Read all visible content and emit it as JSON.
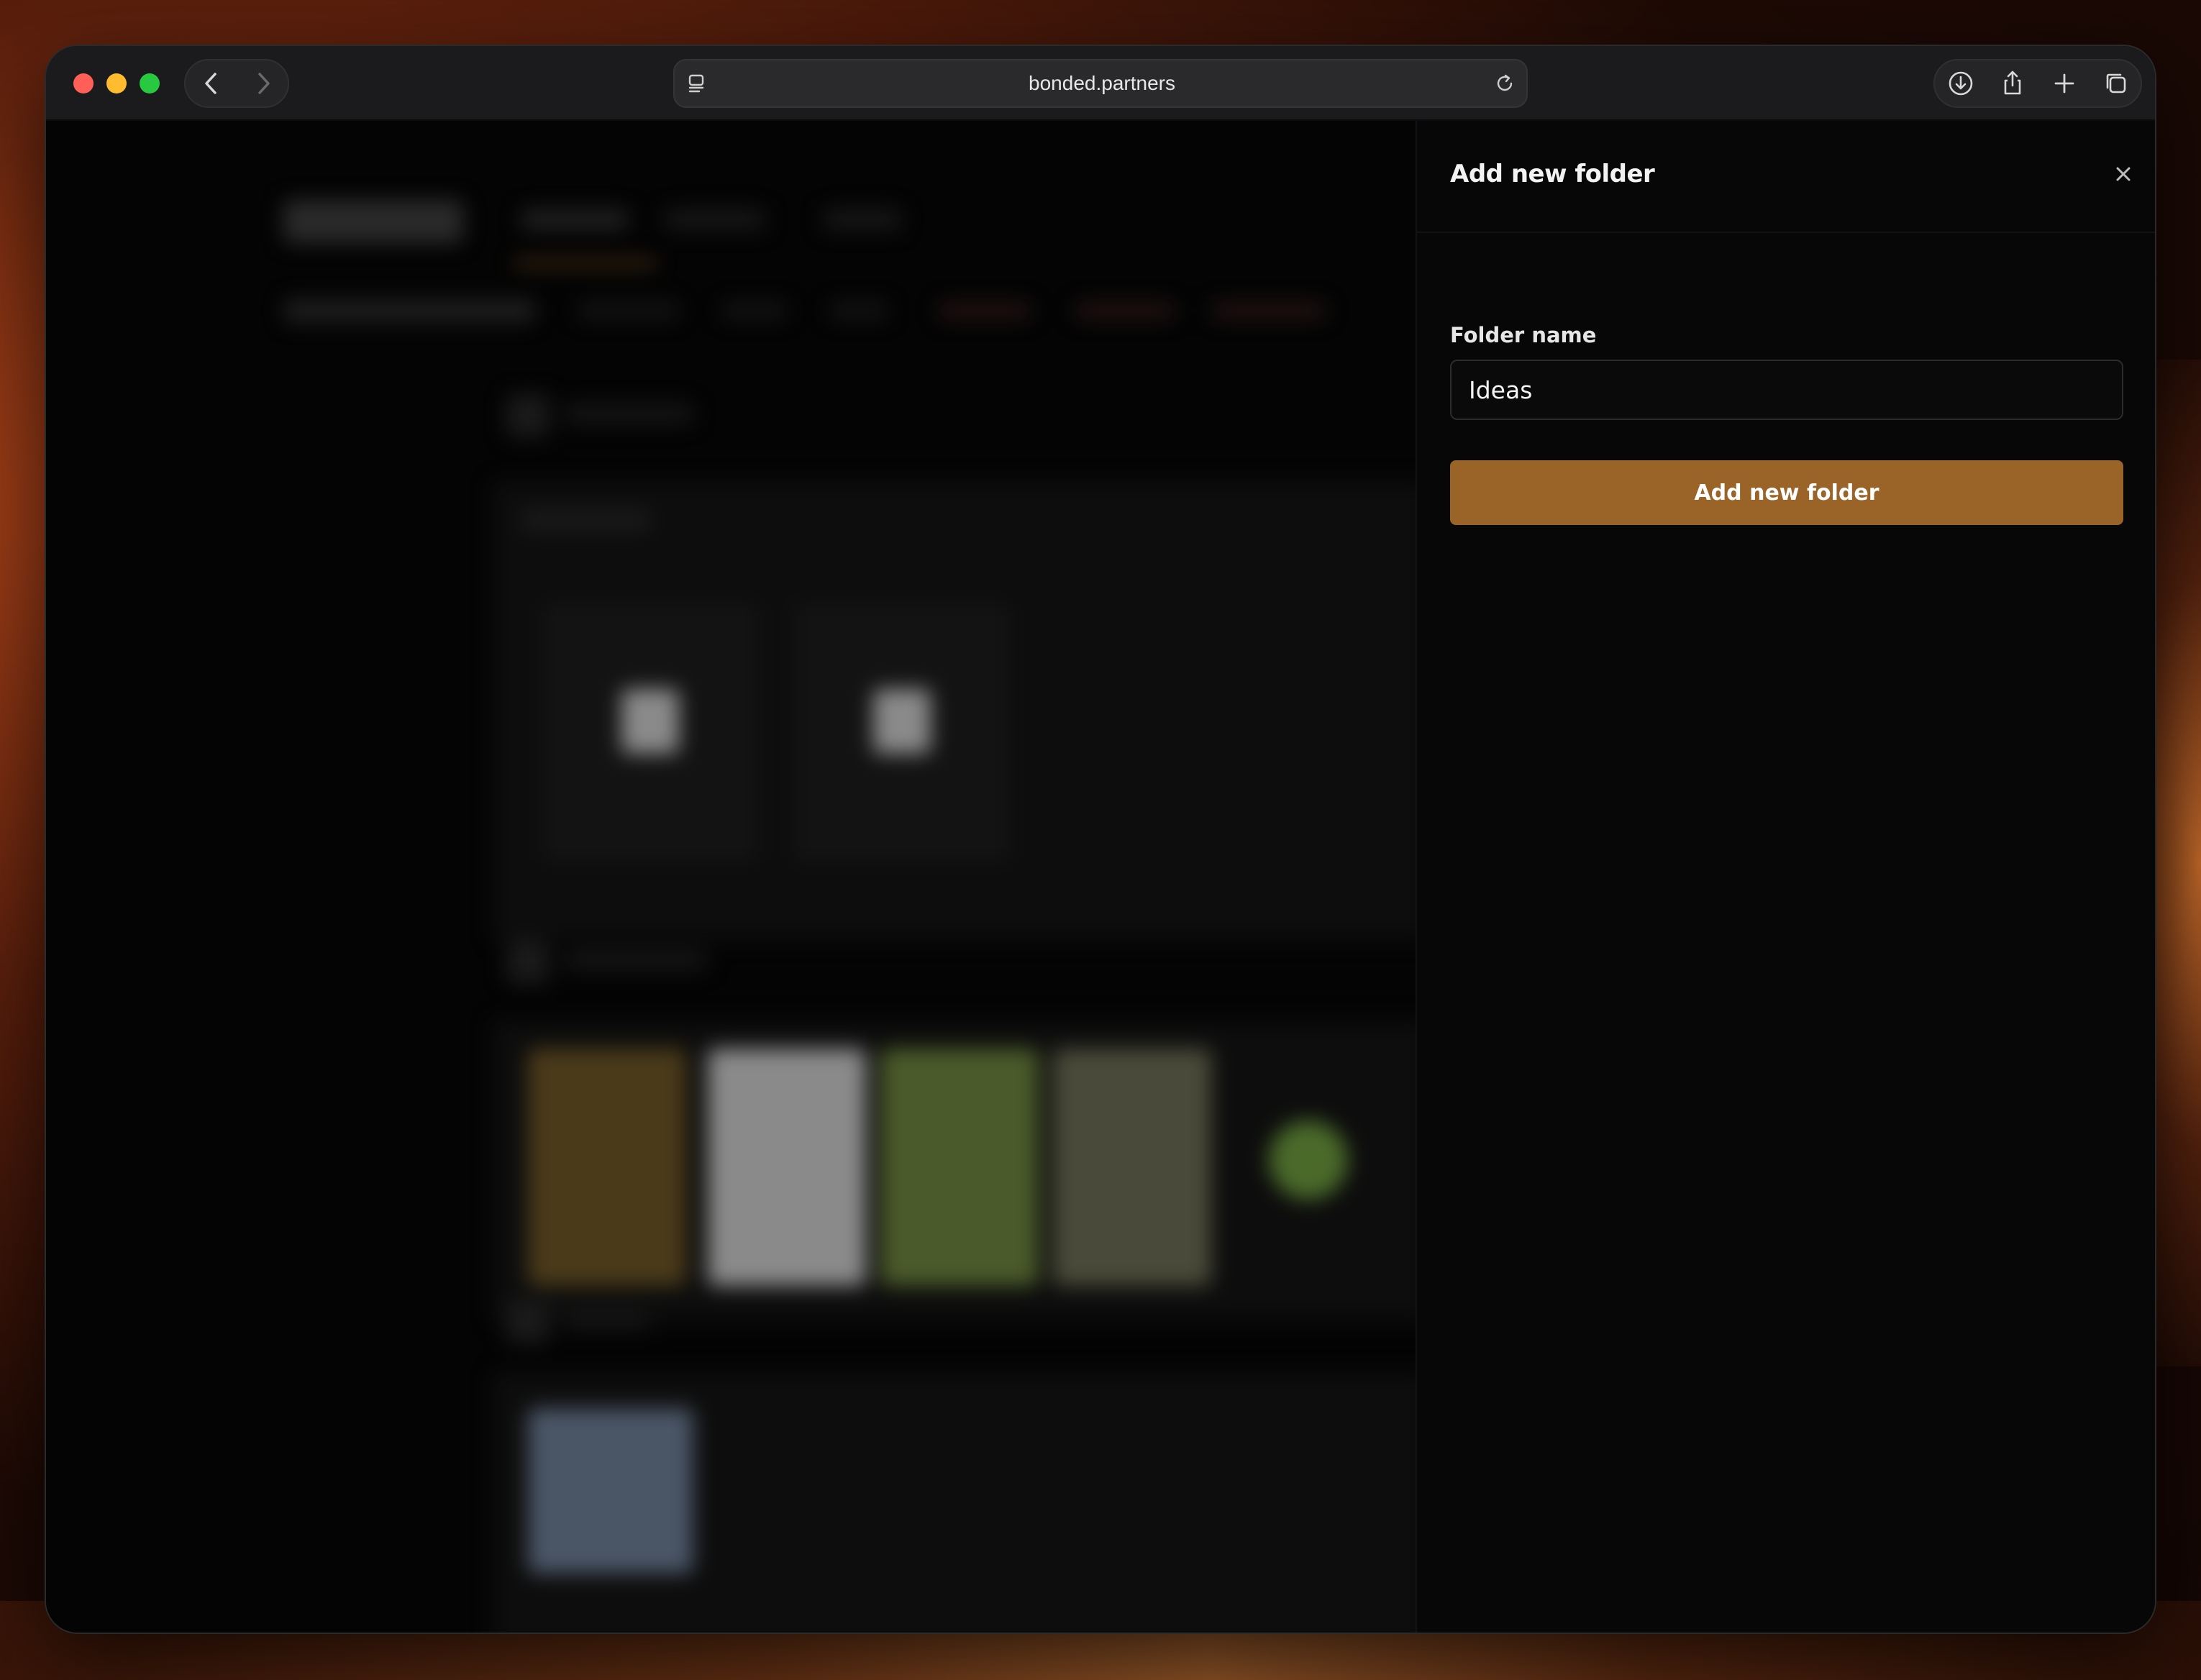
{
  "browser": {
    "url": "bonded.partners",
    "icons": {
      "back": "chevron-left-icon",
      "forward": "chevron-right-icon",
      "page_menu": "page-menu-icon",
      "reload": "reload-icon",
      "downloads": "download-icon",
      "share": "share-icon",
      "new_tab": "plus-icon",
      "tab_overview": "tabs-icon"
    }
  },
  "drawer": {
    "title": "Add new folder",
    "close_icon": "close-icon",
    "form": {
      "label": "Folder name",
      "value": "Ideas",
      "submit_label": "Add new folder"
    }
  },
  "colors": {
    "accent": "#9a6429",
    "drawer_bg": "#070708",
    "input_border": "#2c2c2f"
  }
}
